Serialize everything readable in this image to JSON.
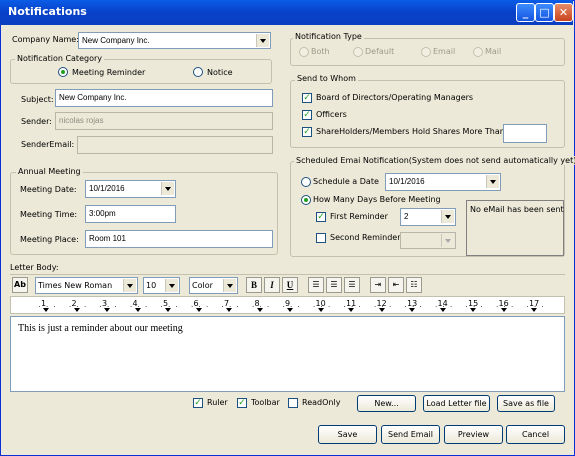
{
  "window": {
    "title": "Notifications"
  },
  "company": {
    "label": "Company Name:",
    "value": "New Company Inc."
  },
  "category": {
    "title": "Notification Category",
    "options": [
      "Meeting Reminder",
      "Notice"
    ]
  },
  "subject": {
    "label": "Subject:",
    "value": "New Company Inc."
  },
  "sender": {
    "label": "Sender:",
    "value": "nicolas rojas"
  },
  "sender_email": {
    "label": "SenderEmail:",
    "value": ""
  },
  "annual": {
    "title": "Annual Meeting",
    "date_label": "Meeting Date:",
    "date_value": "10/1/2016",
    "time_label": "Meeting Time:",
    "time_value": "3:00pm",
    "place_label": "Meeting Place:",
    "place_value": "Room 101"
  },
  "type": {
    "title": "Notification Type",
    "options": [
      "Both",
      "Default",
      "Email",
      "Mail"
    ]
  },
  "send_to": {
    "title": "Send to Whom",
    "options": [
      "Board of Directors/Operating Managers",
      "Officers",
      "ShareHolders/Members Hold Shares More Than:"
    ],
    "shares_value": ""
  },
  "scheduled": {
    "title": "Scheduled Emai Notification(System does not send  automatically yet)",
    "schedule_label": "Schedule a Date",
    "schedule_value": "10/1/2016",
    "days_label": "How Many Days Before Meeting",
    "first_label": "First Reminder",
    "first_value": "2",
    "second_label": "Second Reminder",
    "second_value": "",
    "status": "No eMail has been sent"
  },
  "letter": {
    "label": "Letter Body:",
    "font": "Times New Roman",
    "size": "10",
    "color": "Color",
    "bold": "B",
    "italic": "I",
    "underline": "U",
    "body": "This is just a reminder about our meeting"
  },
  "ruler_numbers": [
    "1",
    "2",
    "3",
    "4",
    "5",
    "6",
    "7",
    "8",
    "9",
    "10",
    "11",
    "12",
    "13",
    "14",
    "15",
    "16",
    "17"
  ],
  "options": {
    "ruler": "Ruler",
    "toolbar": "Toolbar",
    "readonly": "ReadOnly"
  },
  "buttons": {
    "new": "New...",
    "load": "Load Letter file",
    "save_as": "Save as file",
    "save": "Save",
    "send": "Send Email",
    "preview": "Preview",
    "cancel": "Cancel"
  }
}
